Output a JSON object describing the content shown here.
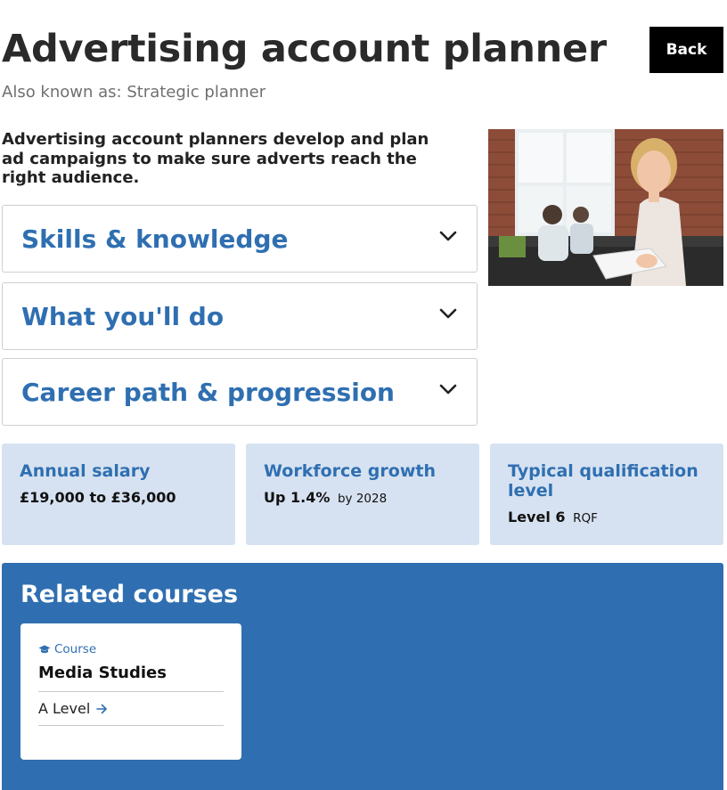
{
  "header": {
    "title": "Advertising account planner",
    "also_known_as": "Also known as: Strategic planner",
    "back_label": "Back"
  },
  "intro": "Advertising account planners develop and plan ad campaigns to make sure adverts reach the right audience.",
  "accordions": [
    {
      "label": "Skills & knowledge"
    },
    {
      "label": "What you'll do"
    },
    {
      "label": "Career path & progression"
    }
  ],
  "stats": [
    {
      "label": "Annual salary",
      "value": "£19,000 to £36,000",
      "suffix": ""
    },
    {
      "label": "Workforce growth",
      "value": "Up 1.4%",
      "suffix": "by 2028"
    },
    {
      "label": "Typical qualification level",
      "value": "Level 6",
      "suffix": "RQF"
    }
  ],
  "related": {
    "title": "Related courses",
    "courses": [
      {
        "tag": "Course",
        "name": "Media Studies",
        "level": "A Level"
      }
    ]
  },
  "colors": {
    "accent": "#2f6fb1",
    "stat_bg": "#d6e2f1",
    "back_button_bg": "#000000"
  }
}
